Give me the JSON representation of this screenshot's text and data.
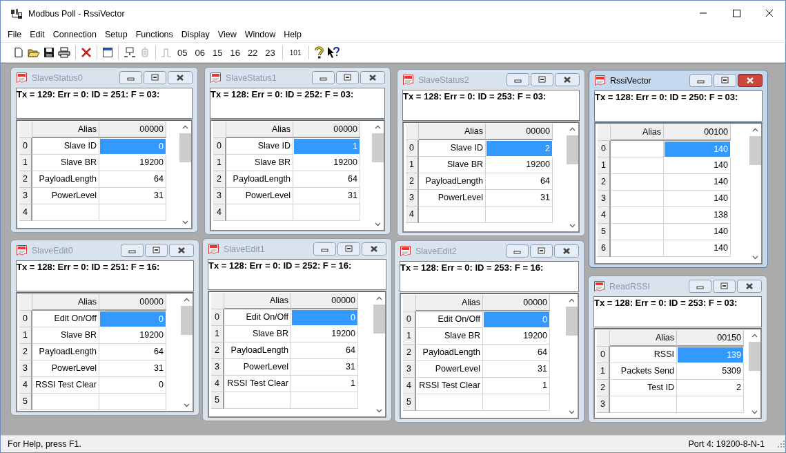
{
  "window": {
    "title": "Modbus Poll - RssiVector"
  },
  "menu": [
    "File",
    "Edit",
    "Connection",
    "Setup",
    "Functions",
    "Display",
    "View",
    "Window",
    "Help"
  ],
  "toolbar": {
    "function_buttons": [
      "05",
      "06",
      "15",
      "16",
      "22",
      "23"
    ],
    "display_button": "101"
  },
  "documents": [
    {
      "title": "SlaveStatus0",
      "active": false,
      "status_line": "Tx = 129: Err = 0: ID = 251: F = 03:",
      "alias_header": "Alias",
      "address_header": "00000",
      "rows": [
        {
          "index": "0",
          "alias": "Slave ID",
          "value": "0",
          "selected": true
        },
        {
          "index": "1",
          "alias": "Slave BR",
          "value": "19200",
          "selected": false
        },
        {
          "index": "2",
          "alias": "PayloadLength",
          "value": "64",
          "selected": false
        },
        {
          "index": "3",
          "alias": "PowerLevel",
          "value": "31",
          "selected": false
        },
        {
          "index": "4",
          "selected": false
        }
      ]
    },
    {
      "title": "SlaveStatus1",
      "active": false,
      "status_line": "Tx = 128: Err = 0: ID = 252: F = 03:",
      "alias_header": "Alias",
      "address_header": "00000",
      "rows": [
        {
          "index": "0",
          "alias": "Slave ID",
          "value": "1",
          "selected": true
        },
        {
          "index": "1",
          "alias": "Slave BR",
          "value": "19200",
          "selected": false
        },
        {
          "index": "2",
          "alias": "PayloadLength",
          "value": "64",
          "selected": false
        },
        {
          "index": "3",
          "alias": "PowerLevel",
          "value": "31",
          "selected": false
        },
        {
          "index": "4",
          "selected": false
        }
      ]
    },
    {
      "title": "SlaveStatus2",
      "active": false,
      "status_line": "Tx = 128: Err = 0: ID = 253: F = 03:",
      "alias_header": "Alias",
      "address_header": "00000",
      "rows": [
        {
          "index": "0",
          "alias": "Slave ID",
          "value": "2",
          "selected": true
        },
        {
          "index": "1",
          "alias": "Slave BR",
          "value": "19200",
          "selected": false
        },
        {
          "index": "2",
          "alias": "PayloadLength",
          "value": "64",
          "selected": false
        },
        {
          "index": "3",
          "alias": "PowerLevel",
          "value": "31",
          "selected": false
        },
        {
          "index": "4",
          "selected": false
        }
      ]
    },
    {
      "title": "RssiVector",
      "active": true,
      "status_line": "Tx = 128: Err = 0: ID = 250: F = 03:",
      "alias_header": "Alias",
      "address_header": "00100",
      "rows": [
        {
          "index": "0",
          "value": "140",
          "selected": true
        },
        {
          "index": "1",
          "value": "140",
          "selected": false
        },
        {
          "index": "2",
          "value": "140",
          "selected": false
        },
        {
          "index": "3",
          "value": "140",
          "selected": false
        },
        {
          "index": "4",
          "value": "138",
          "selected": false
        },
        {
          "index": "5",
          "value": "140",
          "selected": false
        },
        {
          "index": "6",
          "value": "140",
          "selected": false
        }
      ]
    },
    {
      "title": "SlaveEdit0",
      "active": false,
      "status_line": "Tx = 128: Err = 0: ID = 251: F = 16:",
      "alias_header": "Alias",
      "address_header": "00000",
      "rows": [
        {
          "index": "0",
          "alias": "Edit On/Off",
          "value": "0",
          "selected": true
        },
        {
          "index": "1",
          "alias": "Slave BR",
          "value": "19200",
          "selected": false
        },
        {
          "index": "2",
          "alias": "PayloadLength",
          "value": "64",
          "selected": false
        },
        {
          "index": "3",
          "alias": "PowerLevel",
          "value": "31",
          "selected": false
        },
        {
          "index": "4",
          "alias": "RSSI Test Clear",
          "value": "0",
          "selected": false
        },
        {
          "index": "5",
          "selected": false
        }
      ]
    },
    {
      "title": "SlaveEdit1",
      "active": false,
      "status_line": "Tx = 128: Err = 0: ID = 252: F = 16:",
      "alias_header": "Alias",
      "address_header": "00000",
      "rows": [
        {
          "index": "0",
          "alias": "Edit On/Off",
          "value": "0",
          "selected": true
        },
        {
          "index": "1",
          "alias": "Slave BR",
          "value": "19200",
          "selected": false
        },
        {
          "index": "2",
          "alias": "PayloadLength",
          "value": "64",
          "selected": false
        },
        {
          "index": "3",
          "alias": "PowerLevel",
          "value": "31",
          "selected": false
        },
        {
          "index": "4",
          "alias": "RSSI Test Clear",
          "value": "1",
          "selected": false
        },
        {
          "index": "5",
          "selected": false
        }
      ]
    },
    {
      "title": "SlaveEdit2",
      "active": false,
      "status_line": "Tx = 128: Err = 0: ID = 253: F = 16:",
      "alias_header": "Alias",
      "address_header": "00000",
      "rows": [
        {
          "index": "0",
          "alias": "Edit On/Off",
          "value": "0",
          "selected": true
        },
        {
          "index": "1",
          "alias": "Slave BR",
          "value": "19200",
          "selected": false
        },
        {
          "index": "2",
          "alias": "PayloadLength",
          "value": "64",
          "selected": false
        },
        {
          "index": "3",
          "alias": "PowerLevel",
          "value": "31",
          "selected": false
        },
        {
          "index": "4",
          "alias": "RSSI Test Clear",
          "value": "1",
          "selected": false
        },
        {
          "index": "5",
          "selected": false
        }
      ]
    },
    {
      "title": "ReadRSSI",
      "active": false,
      "status_line": "Tx = 128: Err = 0: ID = 253: F = 03:",
      "alias_header": "Alias",
      "address_header": "00150",
      "rows": [
        {
          "index": "0",
          "alias": "RSSI",
          "value": "139",
          "selected": true
        },
        {
          "index": "1",
          "alias": "Packets Send",
          "value": "5309",
          "selected": false
        },
        {
          "index": "2",
          "alias": "Test ID",
          "value": "2",
          "selected": false
        },
        {
          "index": "3",
          "selected": false
        }
      ]
    }
  ],
  "status_bar": {
    "help": "For Help, press F1.",
    "port": "Port 4: 19200-8-N-1"
  }
}
